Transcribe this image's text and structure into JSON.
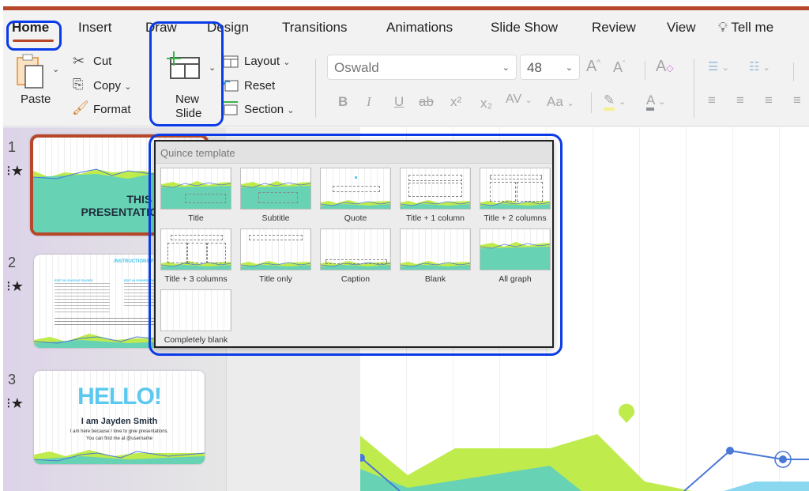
{
  "ribbon": {
    "tabs": [
      "Home",
      "Insert",
      "Draw",
      "Design",
      "Transitions",
      "Animations",
      "Slide Show",
      "Review",
      "View"
    ],
    "active_tab": "Home",
    "tell_me": "Tell me",
    "clipboard": {
      "paste": "Paste",
      "cut": "Cut",
      "copy": "Copy",
      "format": "Format"
    },
    "slides": {
      "new_slide_line1": "New",
      "new_slide_line2": "Slide",
      "layout": "Layout",
      "reset": "Reset",
      "section": "Section"
    },
    "font": {
      "name": "Oswald",
      "size": "48"
    },
    "format_buttons": {
      "bold": "B",
      "italic": "I",
      "underline": "U",
      "strikethrough": "ab",
      "superscript": "x²",
      "subscript": "x₂",
      "spacing": "AV",
      "case": "Aa",
      "grow": "A",
      "shrink": "A"
    }
  },
  "slides_panel": {
    "slides": [
      {
        "number": "1",
        "title_line1": "THIS I",
        "title_line2": "PRESENTATIO",
        "selected": true
      },
      {
        "number": "2",
        "heading": "INSTRUCTIONS FOR USE",
        "col1_head": "EDIT IN GOOGLE SLIDES",
        "col2_head": "EDIT IN POWERPOINT®"
      },
      {
        "number": "3",
        "hello": "HELLO!",
        "name": "I am Jayden Smith",
        "line1": "I am here because I love to give presentations.",
        "line2": "You can find me at @username"
      }
    ]
  },
  "layout_menu": {
    "title": "Quince template",
    "layouts": [
      "Title",
      "Subtitle",
      "Quote",
      "Title + 1 column",
      "Title + 2 columns",
      "Title + 3 columns",
      "Title only",
      "Caption",
      "Blank",
      "All graph",
      "Completely blank"
    ]
  },
  "colors": {
    "accent": "#b7472a",
    "highlight": "#0a3be8",
    "teal": "#67d3b4",
    "lime": "#bfeb4c",
    "blue_line": "#4a78d6",
    "sky": "#8ad7f0"
  }
}
